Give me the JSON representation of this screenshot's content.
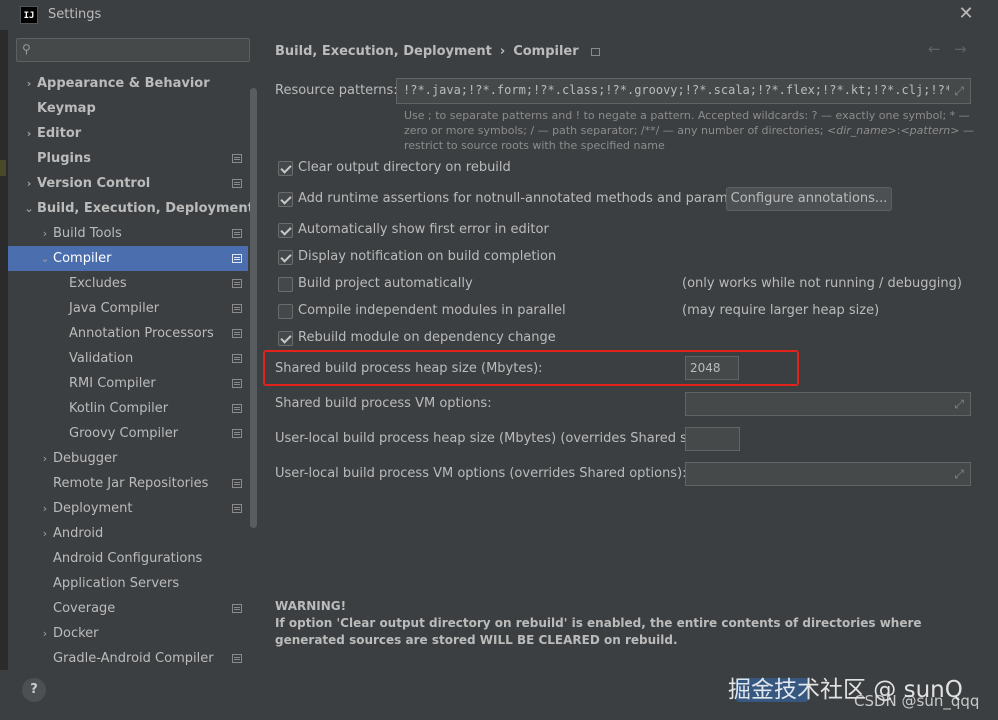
{
  "window": {
    "title": "Settings",
    "app_icon": "IJ"
  },
  "search": {
    "placeholder": ""
  },
  "tree": [
    {
      "label": "Appearance & Behavior",
      "bold": true,
      "arrow": "right",
      "indent": 0,
      "icon": false
    },
    {
      "label": "Keymap",
      "bold": true,
      "arrow": "",
      "indent": 0,
      "icon": false
    },
    {
      "label": "Editor",
      "bold": true,
      "arrow": "right",
      "indent": 0,
      "icon": false
    },
    {
      "label": "Plugins",
      "bold": true,
      "arrow": "",
      "indent": 0,
      "icon": true
    },
    {
      "label": "Version Control",
      "bold": true,
      "arrow": "right",
      "indent": 0,
      "icon": true
    },
    {
      "label": "Build, Execution, Deployment",
      "bold": true,
      "arrow": "down",
      "indent": 0,
      "icon": false
    },
    {
      "label": "Build Tools",
      "bold": false,
      "arrow": "right",
      "indent": 1,
      "icon": true
    },
    {
      "label": "Compiler",
      "bold": false,
      "arrow": "down",
      "indent": 1,
      "icon": true,
      "selected": true
    },
    {
      "label": "Excludes",
      "bold": false,
      "arrow": "",
      "indent": 2,
      "icon": true
    },
    {
      "label": "Java Compiler",
      "bold": false,
      "arrow": "",
      "indent": 2,
      "icon": true
    },
    {
      "label": "Annotation Processors",
      "bold": false,
      "arrow": "",
      "indent": 2,
      "icon": true
    },
    {
      "label": "Validation",
      "bold": false,
      "arrow": "",
      "indent": 2,
      "icon": true
    },
    {
      "label": "RMI Compiler",
      "bold": false,
      "arrow": "",
      "indent": 2,
      "icon": true
    },
    {
      "label": "Kotlin Compiler",
      "bold": false,
      "arrow": "",
      "indent": 2,
      "icon": true
    },
    {
      "label": "Groovy Compiler",
      "bold": false,
      "arrow": "",
      "indent": 2,
      "icon": true
    },
    {
      "label": "Debugger",
      "bold": false,
      "arrow": "right",
      "indent": 1,
      "icon": false
    },
    {
      "label": "Remote Jar Repositories",
      "bold": false,
      "arrow": "",
      "indent": 1,
      "icon": true
    },
    {
      "label": "Deployment",
      "bold": false,
      "arrow": "right",
      "indent": 1,
      "icon": true
    },
    {
      "label": "Android",
      "bold": false,
      "arrow": "right",
      "indent": 1,
      "icon": false
    },
    {
      "label": "Android Configurations",
      "bold": false,
      "arrow": "",
      "indent": 1,
      "icon": false
    },
    {
      "label": "Application Servers",
      "bold": false,
      "arrow": "",
      "indent": 1,
      "icon": false
    },
    {
      "label": "Coverage",
      "bold": false,
      "arrow": "",
      "indent": 1,
      "icon": true
    },
    {
      "label": "Docker",
      "bold": false,
      "arrow": "right",
      "indent": 1,
      "icon": false
    },
    {
      "label": "Gradle-Android Compiler",
      "bold": false,
      "arrow": "",
      "indent": 1,
      "icon": true
    }
  ],
  "breadcrumb": {
    "parent": "Build, Execution, Deployment",
    "sep": "›",
    "current": "Compiler"
  },
  "resource": {
    "label": "Resource patterns:",
    "value": "!?*.java;!?*.form;!?*.class;!?*.groovy;!?*.scala;!?*.flex;!?*.kt;!?*.clj;!?*.aj",
    "hint_1": "Use ; to separate patterns and ! to negate a pattern. Accepted wildcards: ? — exactly one symbol; * — zero or more symbols; / — path separator; /**/ — any number of directories; ",
    "hint_dir": "<dir_name>",
    "hint_colon": ":",
    "hint_pattern": "<pattern>",
    "hint_2": " — restrict to source roots with the specified name"
  },
  "options": {
    "clear_output": {
      "label": "Clear output directory on rebuild",
      "checked": true
    },
    "runtime_assertions": {
      "label": "Add runtime assertions for notnull-annotated methods and parameters",
      "checked": true
    },
    "configure_btn": "Configure annotations...",
    "show_first_error": {
      "label": "Automatically show first error in editor",
      "checked": true
    },
    "display_notification": {
      "label": "Display notification on build completion",
      "checked": true
    },
    "build_auto": {
      "label": "Build project automatically",
      "checked": false,
      "note": "(only works while not running / debugging)"
    },
    "compile_parallel": {
      "label": "Compile independent modules in parallel",
      "checked": false,
      "note": "(may require larger heap size)"
    },
    "rebuild_module": {
      "label": "Rebuild module on dependency change",
      "checked": true
    }
  },
  "heap": {
    "label": "Shared build process heap size (Mbytes):",
    "value": "2048"
  },
  "vm_options": {
    "label": "Shared build process VM options:",
    "value": ""
  },
  "user_heap": {
    "label": "User-local build process heap size (Mbytes) (overrides Shared size):",
    "value": ""
  },
  "user_vm": {
    "label": "User-local build process VM options (overrides Shared options):",
    "value": ""
  },
  "warning": {
    "title": "WARNING!",
    "text": "If option 'Clear output directory on rebuild' is enabled, the entire contents of directories where generated sources are stored WILL BE CLEARED on rebuild."
  },
  "help": "?",
  "watermark": {
    "main": "掘金技术社区 @ sunQ",
    "sub": "CSDN @sun_qqq"
  },
  "colors": {
    "selection": "#4b6eaf",
    "highlight": "#e0241b",
    "background": "#3c3f41"
  }
}
